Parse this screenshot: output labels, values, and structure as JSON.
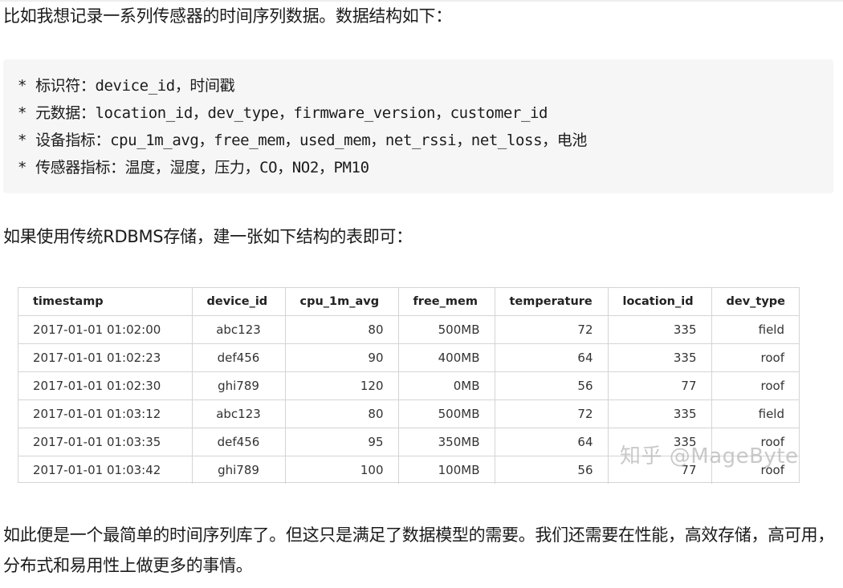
{
  "para1": "比如我想记录一系列传感器的时间序列数据。数据结构如下：",
  "code_lines": [
    "* 标识符：device_id，时间戳",
    "* 元数据：location_id，dev_type，firmware_version，customer_id",
    "* 设备指标：cpu_1m_avg，free_mem，used_mem，net_rssi，net_loss，电池",
    "* 传感器指标：温度，湿度，压力，CO，NO2，PM10"
  ],
  "para2": "如果使用传统RDBMS存储，建一张如下结构的表即可：",
  "table": {
    "headers": [
      "timestamp",
      "device_id",
      "cpu_1m_avg",
      "free_mem",
      "temperature",
      "location_id",
      "dev_type"
    ],
    "rows": [
      [
        "2017-01-01 01:02:00",
        "abc123",
        "80",
        "500MB",
        "72",
        "335",
        "field"
      ],
      [
        "2017-01-01 01:02:23",
        "def456",
        "90",
        "400MB",
        "64",
        "335",
        "roof"
      ],
      [
        "2017-01-01 01:02:30",
        "ghi789",
        "120",
        "0MB",
        "56",
        "77",
        "roof"
      ],
      [
        "2017-01-01 01:03:12",
        "abc123",
        "80",
        "500MB",
        "72",
        "335",
        "field"
      ],
      [
        "2017-01-01 01:03:35",
        "def456",
        "95",
        "350MB",
        "64",
        "335",
        "roof"
      ],
      [
        "2017-01-01 01:03:42",
        "ghi789",
        "100",
        "100MB",
        "56",
        "77",
        "roof"
      ]
    ]
  },
  "watermark": "知乎 @MageByte",
  "para3": "如此便是一个最简单的时间序列库了。但这只是满足了数据模型的需要。我们还需要在性能，高效存储，高可用，分布式和易用性上做更多的事情。"
}
